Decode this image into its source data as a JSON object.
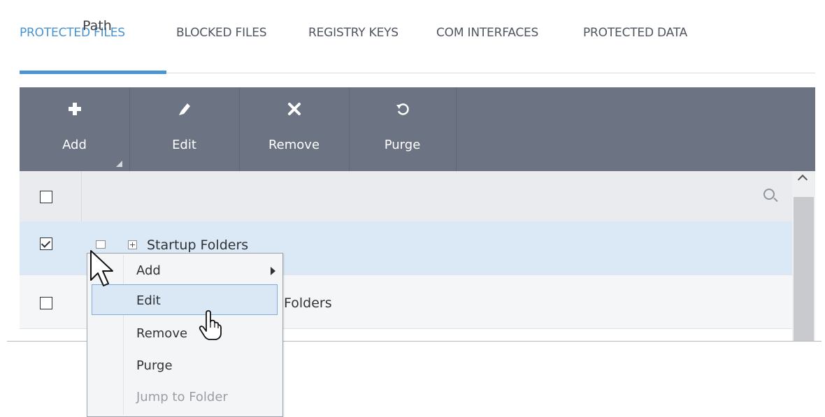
{
  "tabs": [
    {
      "label": "PROTECTED FILES",
      "active": true
    },
    {
      "label": "BLOCKED FILES",
      "active": false
    },
    {
      "label": "REGISTRY KEYS",
      "active": false
    },
    {
      "label": "COM INTERFACES",
      "active": false
    },
    {
      "label": "PROTECTED DATA",
      "active": false
    }
  ],
  "toolbar": {
    "add": {
      "label": "Add",
      "icon": "plus-icon"
    },
    "edit": {
      "label": "Edit",
      "icon": "pencil-icon"
    },
    "remove": {
      "label": "Remove",
      "icon": "x-icon"
    },
    "purge": {
      "label": "Purge",
      "icon": "refresh-icon"
    }
  },
  "table": {
    "columns": [
      "Path"
    ],
    "rows": [
      {
        "path": "Startup Folders",
        "checked": true
      },
      {
        "path": "Folders",
        "checked": false
      }
    ]
  },
  "context_menu": {
    "items": [
      {
        "label": "Add",
        "submenu": true
      },
      {
        "label": "Edit",
        "highlighted": true
      },
      {
        "label": "Remove"
      },
      {
        "label": "Purge"
      },
      {
        "label": "Jump to Folder",
        "disabled": true
      }
    ]
  },
  "colors": {
    "accent": "#4a93cf",
    "toolbar_bg": "#6c7484",
    "selected_row": "#dbe8f5"
  }
}
